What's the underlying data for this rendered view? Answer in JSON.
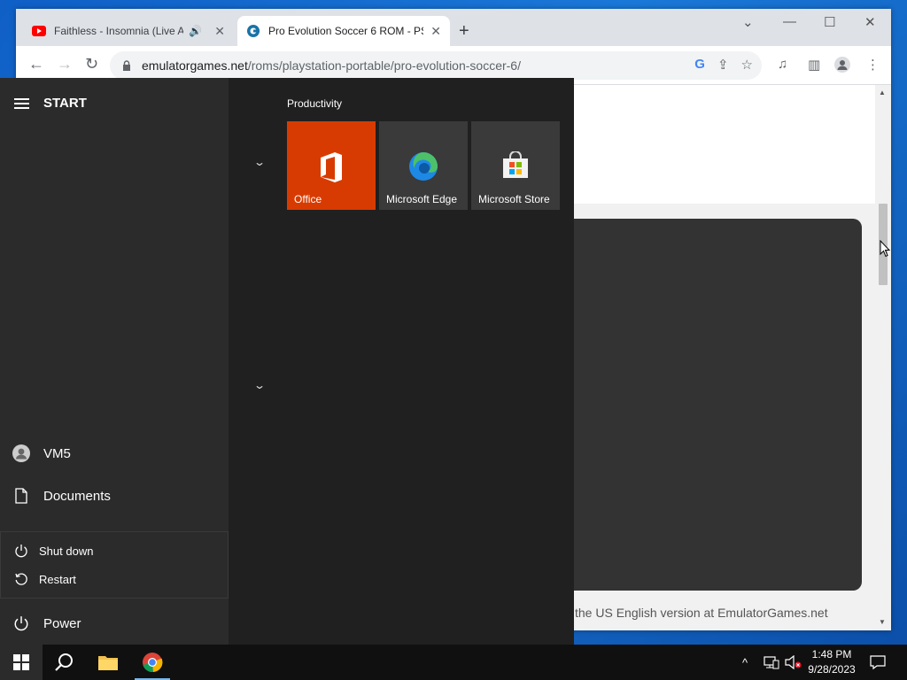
{
  "browser": {
    "tabs": [
      {
        "title": "Faithless - Insomnia (Live At",
        "favicon": "youtube-icon",
        "audio": true
      },
      {
        "title": "Pro Evolution Soccer 6 ROM - PS",
        "favicon": "emulatorgames-icon",
        "audio": false
      }
    ],
    "url_host": "emulatorgames.net",
    "url_path": "/roms/playstation-portable/pro-evolution-soccer-6/",
    "page_snippet": "the US English version at EmulatorGames.net"
  },
  "start_menu": {
    "title": "START",
    "user": "VM5",
    "documents": "Documents",
    "power": "Power",
    "power_options": {
      "shut_down": "Shut down",
      "restart": "Restart"
    },
    "group_label": "Productivity",
    "tiles": [
      {
        "label": "Office",
        "color": "#d83b01"
      },
      {
        "label": "Microsoft Edge",
        "color": "#3a3a3a"
      },
      {
        "label": "Microsoft Store",
        "color": "#3a3a3a"
      }
    ]
  },
  "taskbar": {
    "time": "1:48 PM",
    "date": "9/28/2023",
    "pinned": [
      "start-button",
      "search-icon",
      "file-explorer-icon",
      "chrome-icon"
    ]
  },
  "colors": {
    "accent": "#76b9ed",
    "office_tile": "#d83b01",
    "start_bg": "#202020"
  }
}
